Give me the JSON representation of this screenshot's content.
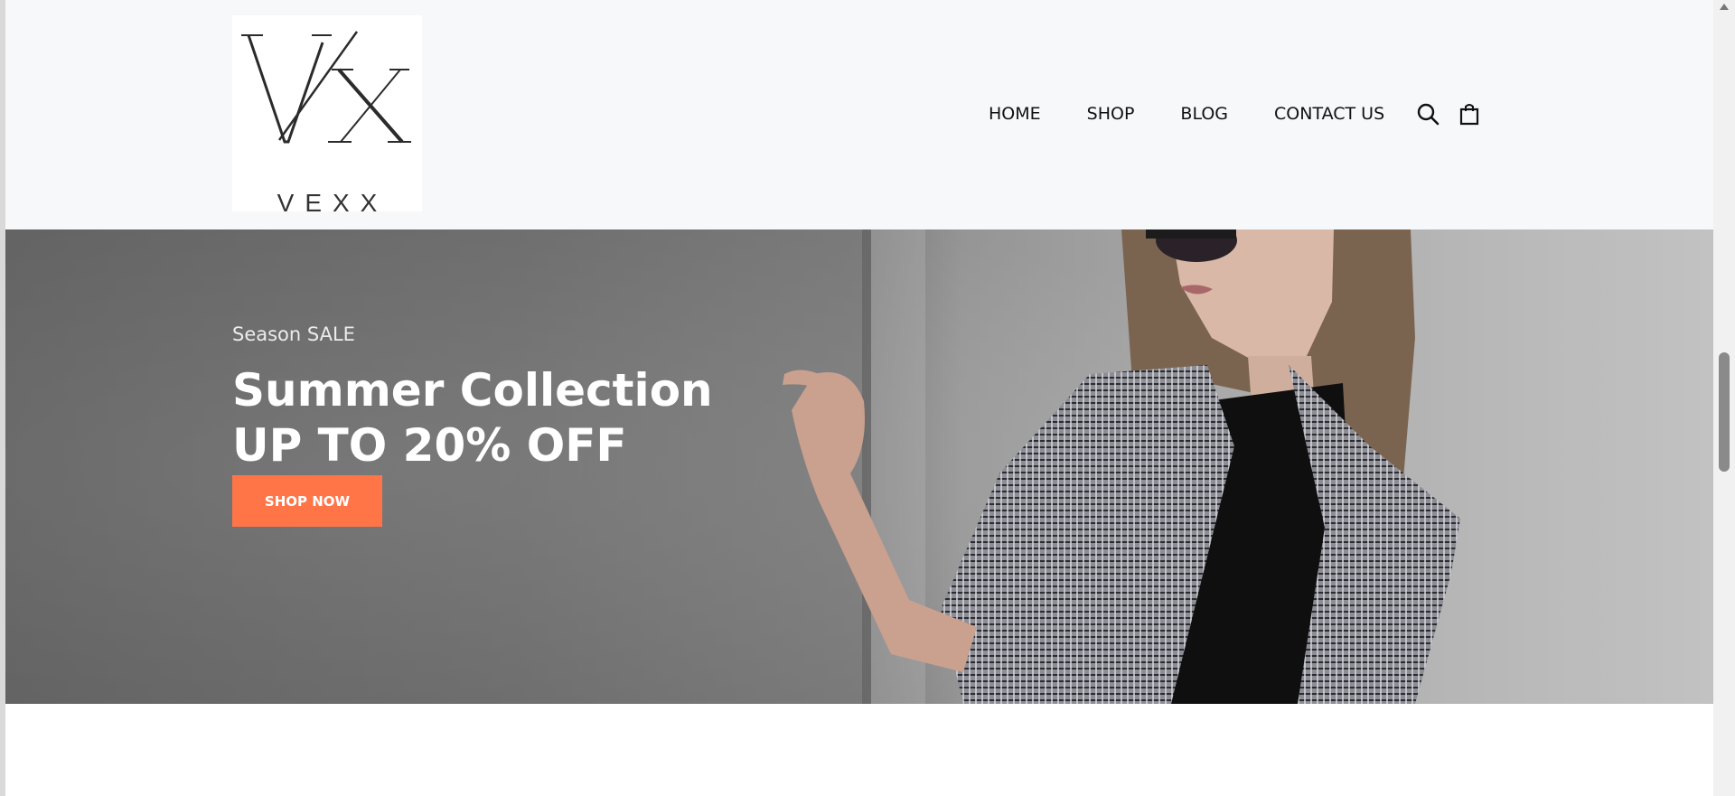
{
  "brand": {
    "name": "VEXX",
    "monogram": "V/X"
  },
  "nav": {
    "items": [
      "HOME",
      "SHOP",
      "BLOG",
      "CONTACT US"
    ],
    "icons": [
      "search-icon",
      "shopping-bag-icon"
    ]
  },
  "hero": {
    "eyebrow": "Season SALE",
    "title_line1": "Summer Collection",
    "title_line2": "UP TO 20% OFF",
    "cta_label": "SHOP NOW"
  },
  "colors": {
    "accent": "#ff7548",
    "header_bg": "#f7f8fa",
    "text_dark": "#111111"
  }
}
